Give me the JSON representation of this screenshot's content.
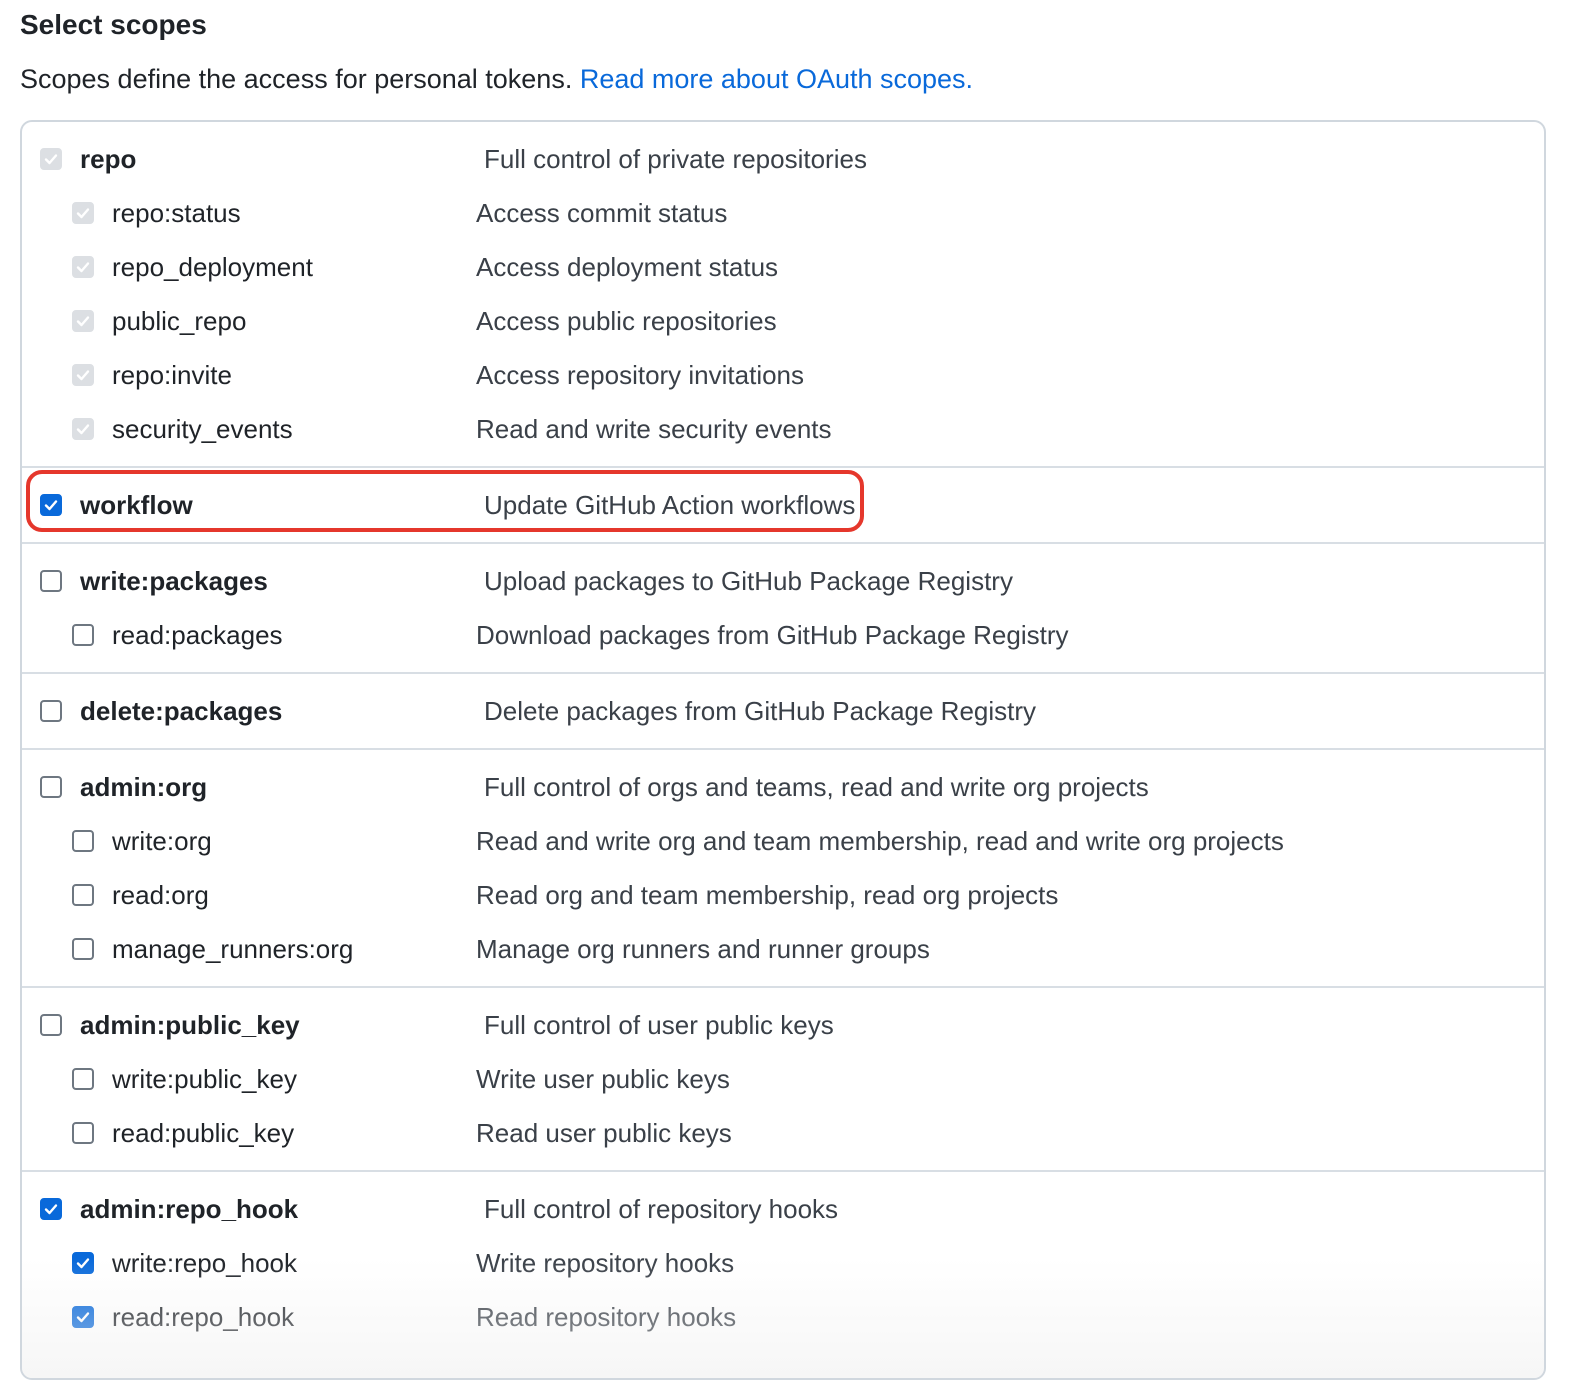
{
  "heading": "Select scopes",
  "intro": {
    "text": "Scopes define the access for personal tokens. ",
    "link": "Read more about OAuth scopes."
  },
  "colors": {
    "accent": "#0969da",
    "highlight": "#e5372c",
    "disabled_check": "#dcdfe3"
  },
  "groups": [
    {
      "parent": {
        "name": "repo",
        "desc": "Full control of private repositories",
        "state": "checked-disabled"
      },
      "children": [
        {
          "name": "repo:status",
          "desc": "Access commit status",
          "state": "checked-disabled"
        },
        {
          "name": "repo_deployment",
          "desc": "Access deployment status",
          "state": "checked-disabled"
        },
        {
          "name": "public_repo",
          "desc": "Access public repositories",
          "state": "checked-disabled"
        },
        {
          "name": "repo:invite",
          "desc": "Access repository invitations",
          "state": "checked-disabled"
        },
        {
          "name": "security_events",
          "desc": "Read and write security events",
          "state": "checked-disabled"
        }
      ]
    },
    {
      "parent": {
        "name": "workflow",
        "desc": "Update GitHub Action workflows",
        "state": "checked"
      },
      "children": []
    },
    {
      "parent": {
        "name": "write:packages",
        "desc": "Upload packages to GitHub Package Registry",
        "state": "unchecked"
      },
      "children": [
        {
          "name": "read:packages",
          "desc": "Download packages from GitHub Package Registry",
          "state": "unchecked"
        }
      ]
    },
    {
      "parent": {
        "name": "delete:packages",
        "desc": "Delete packages from GitHub Package Registry",
        "state": "unchecked"
      },
      "children": []
    },
    {
      "parent": {
        "name": "admin:org",
        "desc": "Full control of orgs and teams, read and write org projects",
        "state": "unchecked"
      },
      "children": [
        {
          "name": "write:org",
          "desc": "Read and write org and team membership, read and write org projects",
          "state": "unchecked"
        },
        {
          "name": "read:org",
          "desc": "Read org and team membership, read org projects",
          "state": "unchecked"
        },
        {
          "name": "manage_runners:org",
          "desc": "Manage org runners and runner groups",
          "state": "unchecked"
        }
      ]
    },
    {
      "parent": {
        "name": "admin:public_key",
        "desc": "Full control of user public keys",
        "state": "unchecked"
      },
      "children": [
        {
          "name": "write:public_key",
          "desc": "Write user public keys",
          "state": "unchecked"
        },
        {
          "name": "read:public_key",
          "desc": "Read user public keys",
          "state": "unchecked"
        }
      ]
    },
    {
      "parent": {
        "name": "admin:repo_hook",
        "desc": "Full control of repository hooks",
        "state": "checked"
      },
      "children": [
        {
          "name": "write:repo_hook",
          "desc": "Write repository hooks",
          "state": "checked"
        },
        {
          "name": "read:repo_hook",
          "desc": "Read repository hooks",
          "state": "checked"
        }
      ]
    }
  ]
}
